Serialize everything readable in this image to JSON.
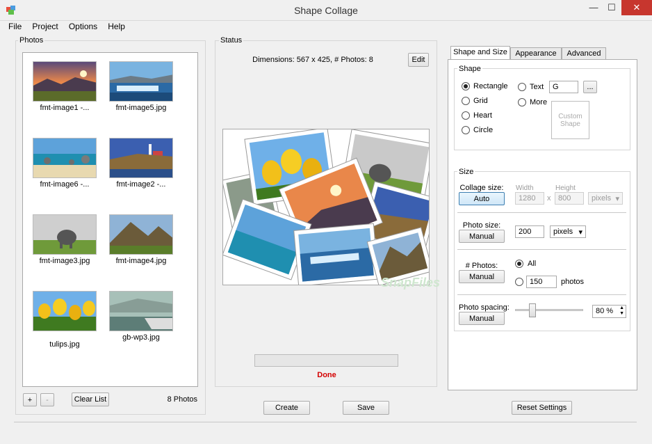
{
  "window": {
    "title": "Shape Collage",
    "minimize": "—",
    "maximize": "☐",
    "close": "✕"
  },
  "menu": [
    "File",
    "Project",
    "Options",
    "Help"
  ],
  "photos": {
    "label": "Photos",
    "items": [
      {
        "caption": "fmt-image1 -..."
      },
      {
        "caption": "fmt-image5.jpg"
      },
      {
        "caption": "fmt-image6 -..."
      },
      {
        "caption": "fmt-image2 -..."
      },
      {
        "caption": "fmt-image3.jpg"
      },
      {
        "caption": "fmt-image4.jpg"
      },
      {
        "caption": "tulips.jpg"
      },
      {
        "caption": "gb-wp3.jpg"
      }
    ],
    "add": "+",
    "remove": "-",
    "clear": "Clear List",
    "count": "8 Photos"
  },
  "status": {
    "label": "Status",
    "dimensions": "Dimensions: 567 x 425, # Photos: 8",
    "edit": "Edit",
    "progress": 0,
    "done": "Done",
    "watermark": "SnapFiles"
  },
  "actions": {
    "create": "Create",
    "save": "Save",
    "reset": "Reset Settings"
  },
  "tabs": [
    "Shape and Size",
    "Appearance",
    "Advanced"
  ],
  "shape": {
    "label": "Shape",
    "options": [
      "Rectangle",
      "Grid",
      "Heart",
      "Circle"
    ],
    "text_option": "Text",
    "text_value": "G",
    "browse": "...",
    "more_option": "More",
    "custom_shape": "Custom Shape",
    "selected": "Rectangle"
  },
  "size": {
    "label": "Size",
    "collage_size": "Collage size:",
    "collage_btn": "Auto",
    "width_label": "Width",
    "height_label": "Height",
    "width_value": "1280",
    "x": "x",
    "height_value": "800",
    "unit_disabled": "pixels",
    "photo_size": "Photo size:",
    "photo_size_btn": "Manual",
    "photo_size_value": "200",
    "photo_size_unit": "pixels",
    "num_photos": "# Photos:",
    "num_photos_btn": "Manual",
    "all": "All",
    "num_value": "150",
    "photos_word": "photos",
    "spacing": "Photo spacing:",
    "spacing_btn": "Manual",
    "spacing_value": "80 %",
    "spacing_level": 0.25
  },
  "colors": {
    "done": "#d40000",
    "close": "#c7362e",
    "accent": "#3c7fb1"
  }
}
